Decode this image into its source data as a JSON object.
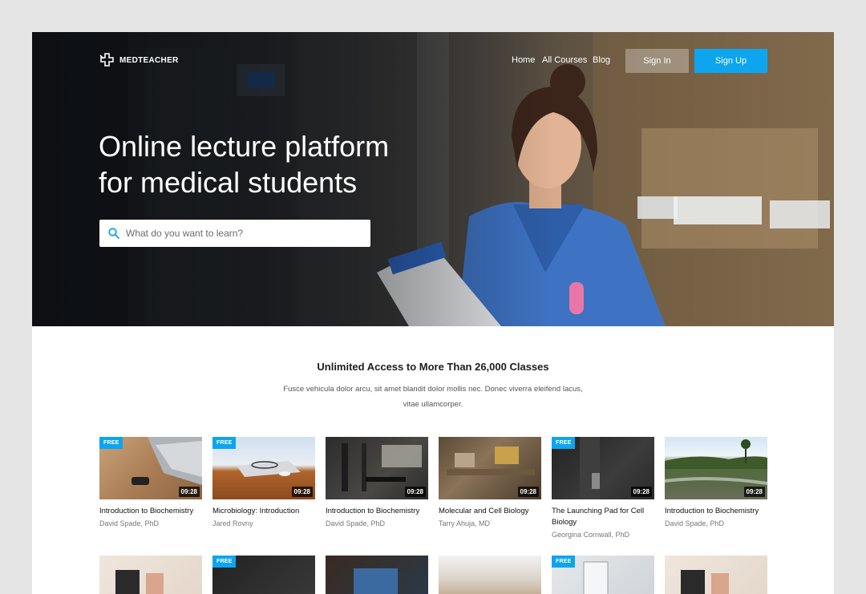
{
  "brand": {
    "name": "MEDTEACHER"
  },
  "nav": {
    "home": "Home",
    "all_courses": "All Courses",
    "blog": "Blog"
  },
  "auth": {
    "sign_in": "Sign In",
    "sign_up": "Sign Up"
  },
  "hero": {
    "headline_line1": "Online lecture platform",
    "headline_line2": "for medical students",
    "search_placeholder": "What do you want to learn?"
  },
  "section": {
    "title": "Unlimited Access to More Than 26,000 Classes",
    "description": "Fusce vehicula dolor arcu, sit amet blandit dolor mollis nec. Donec viverra eleifend lacus, vitae ullamcorper."
  },
  "courses": [
    {
      "title": "Introduction to Biochemistry",
      "author": "David Spade, PhD",
      "duration": "09:28",
      "badge": "FREE"
    },
    {
      "title": "Microbiology: Introduction",
      "author": "Jared Rovny",
      "duration": "09:28",
      "badge": "FREE"
    },
    {
      "title": "Introduction to Biochemistry",
      "author": "David Spade, PhD",
      "duration": "09:28",
      "badge": ""
    },
    {
      "title": "Molecular and Cell Biology",
      "author": "Tarry Ahuja, MD",
      "duration": "09:28",
      "badge": ""
    },
    {
      "title": "The Launching Pad for Cell Biology",
      "author": "Georgina Cornwall, PhD",
      "duration": "09:28",
      "badge": "FREE"
    },
    {
      "title": "Introduction to Biochemistry",
      "author": "David Spade, PhD",
      "duration": "09:28",
      "badge": ""
    }
  ],
  "second_row_badges": [
    "",
    "FREE",
    "",
    "",
    "FREE",
    ""
  ],
  "colors": {
    "accent": "#0ea5ef",
    "background": "#e5e5e5"
  }
}
